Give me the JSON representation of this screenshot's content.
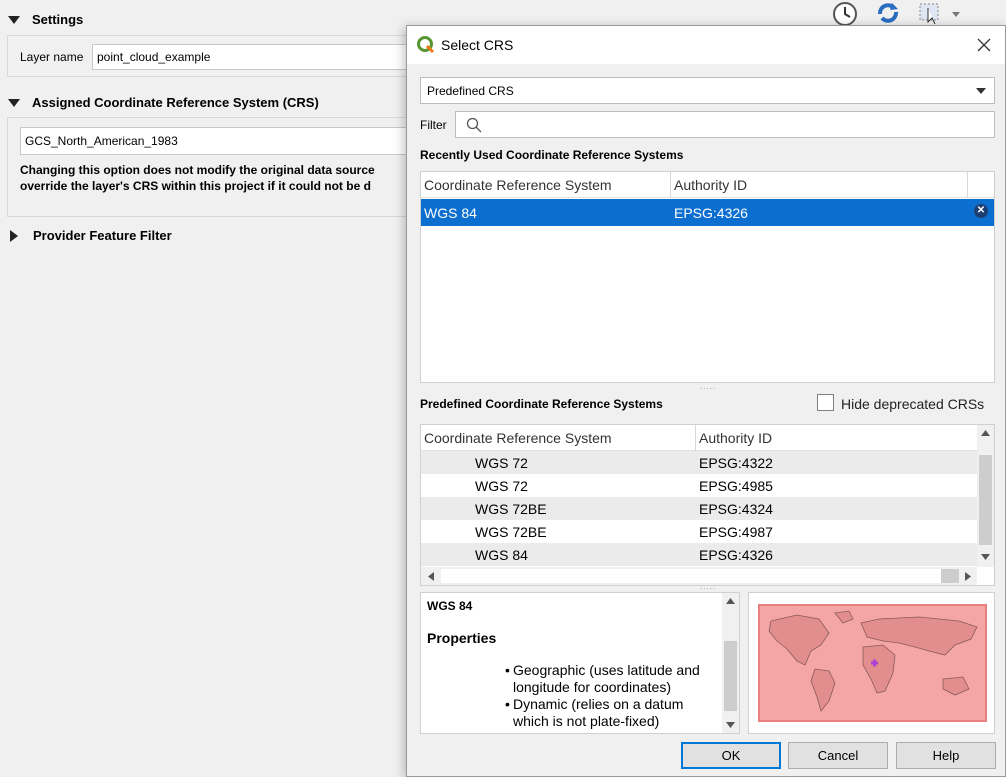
{
  "settings": {
    "title": "Settings",
    "layer_name_label": "Layer name",
    "layer_name_value": "point_cloud_example"
  },
  "assigned_crs": {
    "title": "Assigned Coordinate Reference System (CRS)",
    "value": "GCS_North_American_1983",
    "note_line1": "Changing this option does not modify the original data source",
    "note_line2": "override the layer's CRS within this project if it could not be d"
  },
  "provider_filter": {
    "title": "Provider Feature Filter"
  },
  "top_toolbar": {
    "icons": [
      "clock-icon",
      "refresh-icon",
      "select-icon"
    ]
  },
  "dialog": {
    "title": "Select CRS",
    "mode_select": "Predefined CRS",
    "filter_label": "Filter",
    "filter_value": "",
    "recent": {
      "title": "Recently Used Coordinate Reference Systems",
      "columns": [
        "Coordinate Reference System",
        "Authority ID"
      ],
      "rows": [
        {
          "name": "WGS 84",
          "id": "EPSG:4326",
          "selected": true
        }
      ]
    },
    "predefined": {
      "title": "Predefined Coordinate Reference Systems",
      "hide_deprecated_label": "Hide deprecated CRSs",
      "hide_deprecated_checked": false,
      "columns": [
        "Coordinate Reference System",
        "Authority ID"
      ],
      "rows": [
        {
          "name": "WGS 72",
          "id": "EPSG:4322"
        },
        {
          "name": "WGS 72",
          "id": "EPSG:4985"
        },
        {
          "name": "WGS 72BE",
          "id": "EPSG:4324"
        },
        {
          "name": "WGS 72BE",
          "id": "EPSG:4987"
        },
        {
          "name": "WGS 84",
          "id": "EPSG:4326"
        }
      ]
    },
    "details": {
      "crs_name": "WGS 84",
      "properties_heading": "Properties",
      "bullets": [
        "Geographic (uses latitude and longitude for coordinates)",
        "Dynamic (relies on a datum which is not plate-fixed)"
      ]
    },
    "buttons": {
      "ok": "OK",
      "cancel": "Cancel",
      "help": "Help"
    },
    "colors": {
      "selection": "#0c6fd0",
      "map_fill": "#f4a6a6",
      "map_border": "#e88080",
      "marker": "#b040d0"
    }
  }
}
